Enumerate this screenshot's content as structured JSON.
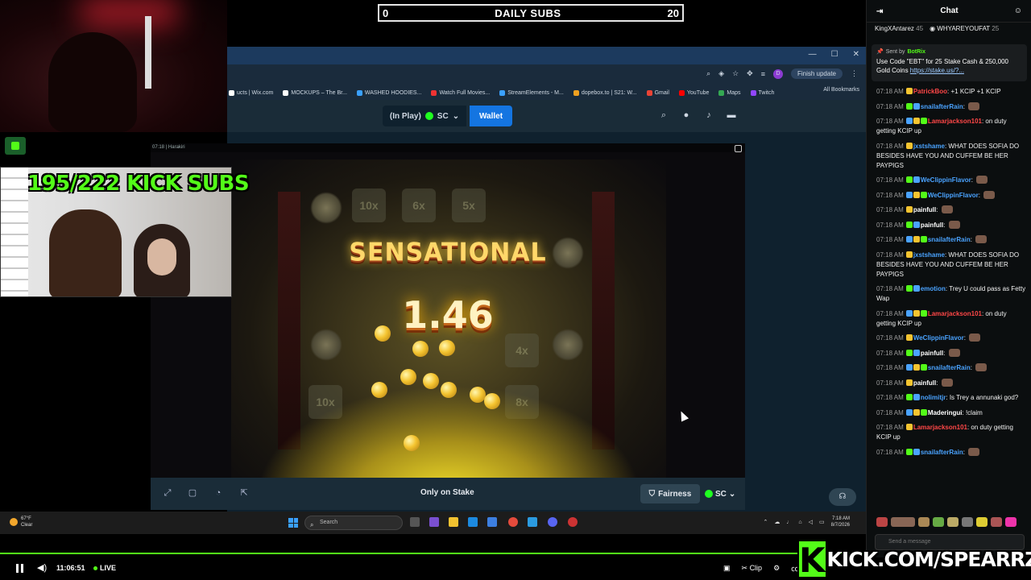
{
  "overlay": {
    "daily_subs_left": "0",
    "daily_subs_title": "DAILY SUBS",
    "daily_subs_right": "20",
    "kick_subs": "195/222 KICK SUBS",
    "kick_logo": "K",
    "kick_url": "KICK.COM/SPEARRZ"
  },
  "browser": {
    "finish_update": "Finish update",
    "profile_initial": "D",
    "bookmarks": [
      "ucts | Wix.com",
      "MOCKUPS – The Br...",
      "WASHED HOODIES...",
      "Watch Full Movies...",
      "StreamElements - M...",
      "dopebox.to | S21: W...",
      "Gmail",
      "YouTube",
      "Maps",
      "Twitch"
    ],
    "all_bookmarks": "All Bookmarks"
  },
  "stake": {
    "in_play_label": "(In Play)",
    "currency": "SC",
    "wallet_label": "Wallet",
    "game_title": "07:18 | Harakiri",
    "win_banner": "SENSATIONAL",
    "win_multiplier": "1.46",
    "tile_values": [
      "10x",
      "6x",
      "5x",
      "4x",
      "10x",
      "8x"
    ],
    "only_on": "Only on Stake",
    "fairness_label": "Fairness",
    "footer_currency": "SC"
  },
  "taskbar": {
    "weather_temp": "67°F",
    "weather_desc": "Clear",
    "search_placeholder": "Search",
    "time": "7:18 AM",
    "date": "8/7/2026"
  },
  "player": {
    "elapsed": "11:06:51",
    "live_label": "LIVE",
    "clip_label": "Clip"
  },
  "chat": {
    "title": "Chat",
    "gifter1_name": "KingXAntarez",
    "gifter1_count": "45",
    "gifter2_name": "WHYAREYOUFAT",
    "gifter2_count": "25",
    "pinned_sent_by": "Sent by",
    "pinned_bot": "BotRix",
    "pinned_text": "Use Code \"EBT\" for 25 Stake Cash & 250,000 Gold Coins ",
    "pinned_link": "https://stake.us/?...",
    "input_placeholder": "Send a message",
    "colors": {
      "red": "#ff4747",
      "blue": "#4aa3ff",
      "green": "#53fc18",
      "pink": "#ff6ad5"
    },
    "messages": [
      {
        "time": "07:18 AM",
        "user": "PatrickBoo",
        "color": "#ff4747",
        "text": "+1 KCIP +1 KCIP"
      },
      {
        "time": "07:18 AM",
        "user": "snailafterRain",
        "color": "#4aa3ff",
        "text": ""
      },
      {
        "time": "07:18 AM",
        "user": "Lamarjackson101",
        "color": "#ff4747",
        "text": "on duty getting KCIP up"
      },
      {
        "time": "07:18 AM",
        "user": "jxstshame",
        "color": "#4aa3ff",
        "text": "WHAT DOES SOFIA DO BESIDES HAVE YOU AND CUFFEM BE HER PAYPIGS"
      },
      {
        "time": "07:18 AM",
        "user": "WeClippinFlavor",
        "color": "#4aa3ff",
        "text": ""
      },
      {
        "time": "07:18 AM",
        "user": "WeClippinFlavor",
        "color": "#4aa3ff",
        "text": ""
      },
      {
        "time": "07:18 AM",
        "user": "painfull",
        "color": "#ffffff",
        "text": ""
      },
      {
        "time": "07:18 AM",
        "user": "painfull",
        "color": "#ffffff",
        "text": ""
      },
      {
        "time": "07:18 AM",
        "user": "snailafterRain",
        "color": "#4aa3ff",
        "text": ""
      },
      {
        "time": "07:18 AM",
        "user": "jxstshame",
        "color": "#4aa3ff",
        "text": "WHAT DOES SOFIA DO BESIDES HAVE YOU AND CUFFEM BE HER PAYPIGS"
      },
      {
        "time": "07:18 AM",
        "user": "emotion",
        "color": "#4aa3ff",
        "text": "Trey U could pass as Fetty Wap"
      },
      {
        "time": "07:18 AM",
        "user": "Lamarjackson101",
        "color": "#ff4747",
        "text": "on duty getting KCIP up"
      },
      {
        "time": "07:18 AM",
        "user": "WeClippinFlavor",
        "color": "#4aa3ff",
        "text": ""
      },
      {
        "time": "07:18 AM",
        "user": "painfull",
        "color": "#ffffff",
        "text": ""
      },
      {
        "time": "07:18 AM",
        "user": "snailafterRain",
        "color": "#4aa3ff",
        "text": ""
      },
      {
        "time": "07:18 AM",
        "user": "painfull",
        "color": "#ffffff",
        "text": ""
      },
      {
        "time": "07:18 AM",
        "user": "nolimitjr",
        "color": "#4aa3ff",
        "text": "Is Trey a annunaki god?"
      },
      {
        "time": "07:18 AM",
        "user": "Maderingui",
        "color": "#ffffff",
        "text": "!claim"
      },
      {
        "time": "07:18 AM",
        "user": "Lamarjackson101",
        "color": "#ff4747",
        "text": "on duty getting KCIP up"
      },
      {
        "time": "07:18 AM",
        "user": "snailafterRain",
        "color": "#4aa3ff",
        "text": ""
      }
    ]
  }
}
